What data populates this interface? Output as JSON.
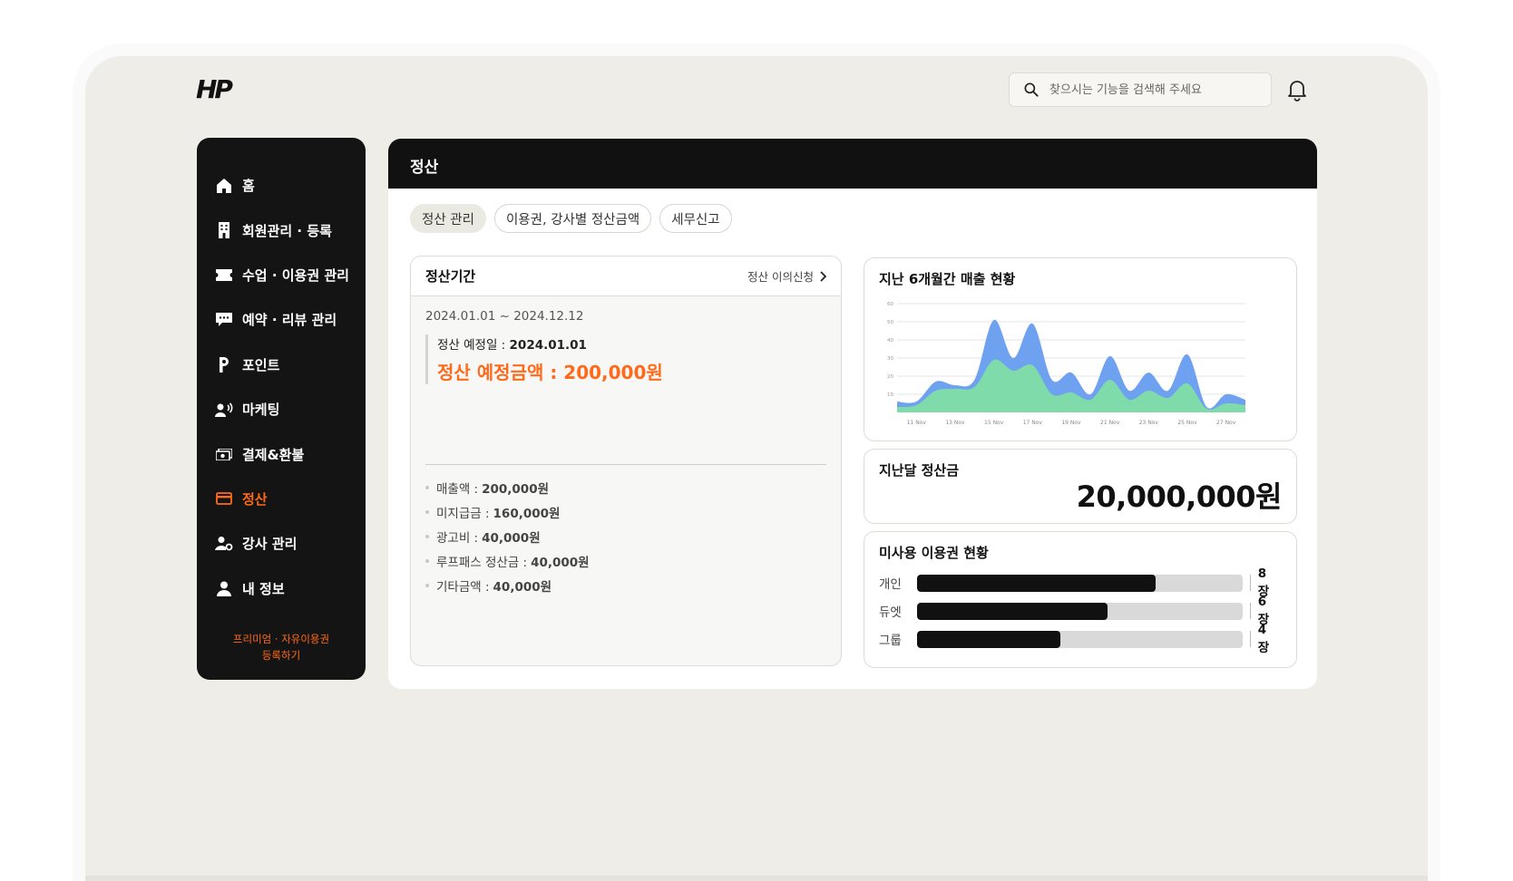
{
  "brand": {
    "logo": "HP"
  },
  "search": {
    "placeholder": "찾으시는 기능을 검색해 주세요"
  },
  "sidebar": {
    "items": [
      {
        "label": "홈",
        "icon": "home-icon"
      },
      {
        "label": "회원관리 · 등록",
        "icon": "building-icon"
      },
      {
        "label": "수업 · 이용권 관리",
        "icon": "ticket-icon"
      },
      {
        "label": "예약 · 리뷰 관리",
        "icon": "chat-icon"
      },
      {
        "label": "포인트",
        "icon": "point-icon"
      },
      {
        "label": "마케팅",
        "icon": "speaker-user-icon"
      },
      {
        "label": "결제&환불",
        "icon": "cash-icon"
      },
      {
        "label": "정산",
        "icon": "card-icon"
      },
      {
        "label": "강사 관리",
        "icon": "user-gear-icon"
      },
      {
        "label": "내 정보",
        "icon": "person-icon"
      }
    ],
    "active_index": 7,
    "active_color": "#ff6a1a",
    "promo_line1": "프리미엄 · 자유이용권",
    "promo_line2": "등록하기"
  },
  "main": {
    "title": "정산",
    "tabs": [
      {
        "label": "정산 관리",
        "active": true
      },
      {
        "label": "이용권, 강사별 정산금액",
        "active": false
      },
      {
        "label": "세무신고",
        "active": false
      }
    ]
  },
  "settlement": {
    "title": "정산기간",
    "appeal_link": "정산 이의신청",
    "period": "2024.01.01 ~ 2024.12.12",
    "due_date_label": "정산 예정일 : ",
    "due_date": "2024.01.01",
    "due_amount": "정산 예정금액 : 200,000원",
    "breakdown": [
      {
        "label": "매출액 :",
        "value": "200,000원"
      },
      {
        "label": "미지급금 :",
        "value": "160,000원"
      },
      {
        "label": "광고비 :",
        "value": "40,000원"
      },
      {
        "label": "루프패스 정산금 :",
        "value": "40,000원"
      },
      {
        "label": "기타금액 :",
        "value": "40,000원"
      }
    ]
  },
  "sales_card": {
    "title": "지난 6개월간 매출 현황"
  },
  "chart_data": {
    "type": "area",
    "title": "지난 6개월간 매출 현황",
    "x": [
      "10 Nov",
      "11 Nov",
      "12 Nov",
      "13 Nov",
      "14 Nov",
      "15 Nov",
      "16 Nov",
      "17 Nov",
      "18 Nov",
      "19 Nov",
      "20 Nov",
      "21 Nov",
      "22 Nov",
      "23 Nov",
      "24 Nov",
      "25 Nov",
      "26 Nov",
      "27 Nov",
      "28 Nov"
    ],
    "tick_labels": [
      "11 Nov",
      "13 Nov",
      "15 Nov",
      "17 Nov",
      "19 Nov",
      "21 Nov",
      "23 Nov",
      "25 Nov",
      "27 Nov"
    ],
    "y_ticks": [
      10,
      20,
      30,
      40,
      50,
      60
    ],
    "ylim": [
      0,
      60
    ],
    "grid": true,
    "series": [
      {
        "color": "#6ea2f0",
        "values": [
          6,
          6,
          17,
          15,
          18,
          51,
          30,
          49,
          18,
          22,
          10,
          31,
          12,
          22,
          12,
          32,
          3,
          10,
          7
        ]
      },
      {
        "color": "#7fdcaa",
        "values": [
          3,
          4,
          12,
          13,
          14,
          29,
          23,
          26,
          10,
          11,
          7,
          18,
          7,
          12,
          8,
          16,
          2,
          5,
          4
        ]
      }
    ]
  },
  "last_month": {
    "title": "지난달 정산금",
    "amount": "20,000,000원"
  },
  "unused": {
    "title": "미사용 이용권 현황",
    "rows": [
      {
        "label": "개인",
        "count": "8 장",
        "ratio": 0.733
      },
      {
        "label": "듀엣",
        "count": "6 장",
        "ratio": 0.585
      },
      {
        "label": "그룹",
        "count": "4 장",
        "ratio": 0.44
      }
    ]
  }
}
